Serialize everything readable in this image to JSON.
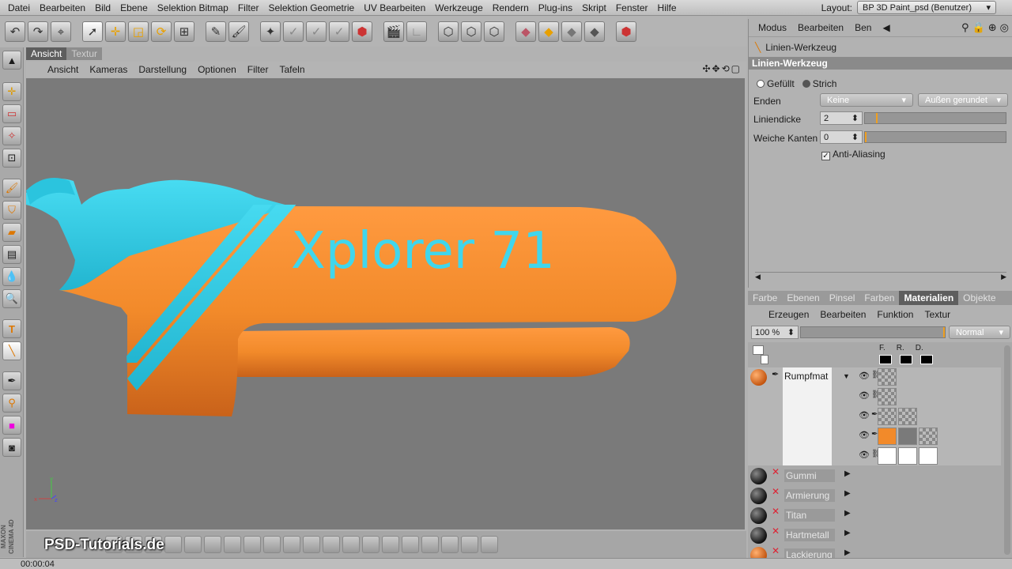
{
  "menubar": {
    "items": [
      "Datei",
      "Bearbeiten",
      "Bild",
      "Ebene",
      "Selektion Bitmap",
      "Filter",
      "Selektion Geometrie",
      "UV Bearbeiten",
      "Werkzeuge",
      "Rendern",
      "Plug-ins",
      "Skript",
      "Fenster",
      "Hilfe"
    ],
    "layout_label": "Layout:",
    "layout_value": "BP 3D Paint_psd (Benutzer)"
  },
  "viewport": {
    "tabs": [
      "Ansicht",
      "Textur"
    ],
    "menu": [
      "Ansicht",
      "Kameras",
      "Darstellung",
      "Optionen",
      "Filter",
      "Tafeln"
    ],
    "nav_icons": "✣✥⟲▢",
    "model_text": "Xplorer 71",
    "axis_x": "x",
    "axis_y": "y",
    "axis_z": "z",
    "colors": {
      "hull": "#f28a2a",
      "accent": "#35d3ec",
      "background": "#7a7a7a"
    }
  },
  "attributes": {
    "menu": [
      "Modus",
      "Bearbeiten",
      "Ben"
    ],
    "tool_name": "Linien-Werkzeug",
    "section_title": "Linien-Werkzeug",
    "fill_option_1": "Gefüllt",
    "fill_option_2": "Strich",
    "enden_label": "Enden",
    "enden_start": "Keine",
    "enden_end": "Außen gerundet",
    "liniendicke_label": "Liniendicke",
    "liniendicke_value": "2",
    "weiche_label": "Weiche Kanten",
    "weiche_value": "0",
    "antialias_label": "Anti-Aliasing"
  },
  "materials_panel": {
    "tabs": [
      "Farbe",
      "Ebenen",
      "Pinsel",
      "Farben",
      "Materialien",
      "Objekte"
    ],
    "active_tab": "Materialien",
    "menu": [
      "Erzeugen",
      "Bearbeiten",
      "Funktion",
      "Textur"
    ],
    "zoom": "100 %",
    "blend_mode": "Normal",
    "channel_headers": [
      "F.",
      "R.",
      "D."
    ],
    "active_material": "Rumpfmat",
    "materials": [
      "Gummi",
      "Armierung",
      "Titan",
      "Hartmetall",
      "Lackierung"
    ]
  },
  "watermark": "PSD-Tutorials.de",
  "maxon_logo": "MAXON CINEMA 4D",
  "status": {
    "time": "00:00:04"
  }
}
